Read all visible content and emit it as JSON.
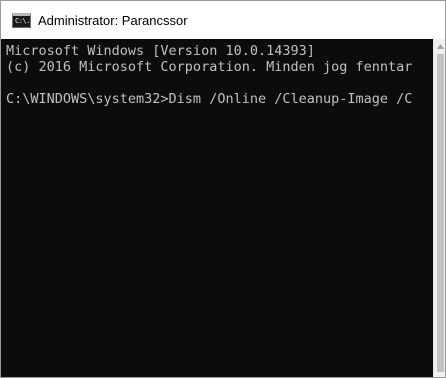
{
  "window": {
    "title": "Administrator: Parancssor",
    "icon": "cmd-icon",
    "icon_text": "C:\\."
  },
  "console": {
    "lines": [
      "Microsoft Windows [Version 10.0.14393]",
      "(c) 2016 Microsoft Corporation. Minden jog fenntar",
      "",
      "C:\\WINDOWS\\system32>Dism /Online /Cleanup-Image /C"
    ],
    "background_color": "#0c0c0c",
    "text_color": "#c0c0c0"
  },
  "scrollbar": {
    "up_icon": "chevron-up-icon"
  }
}
